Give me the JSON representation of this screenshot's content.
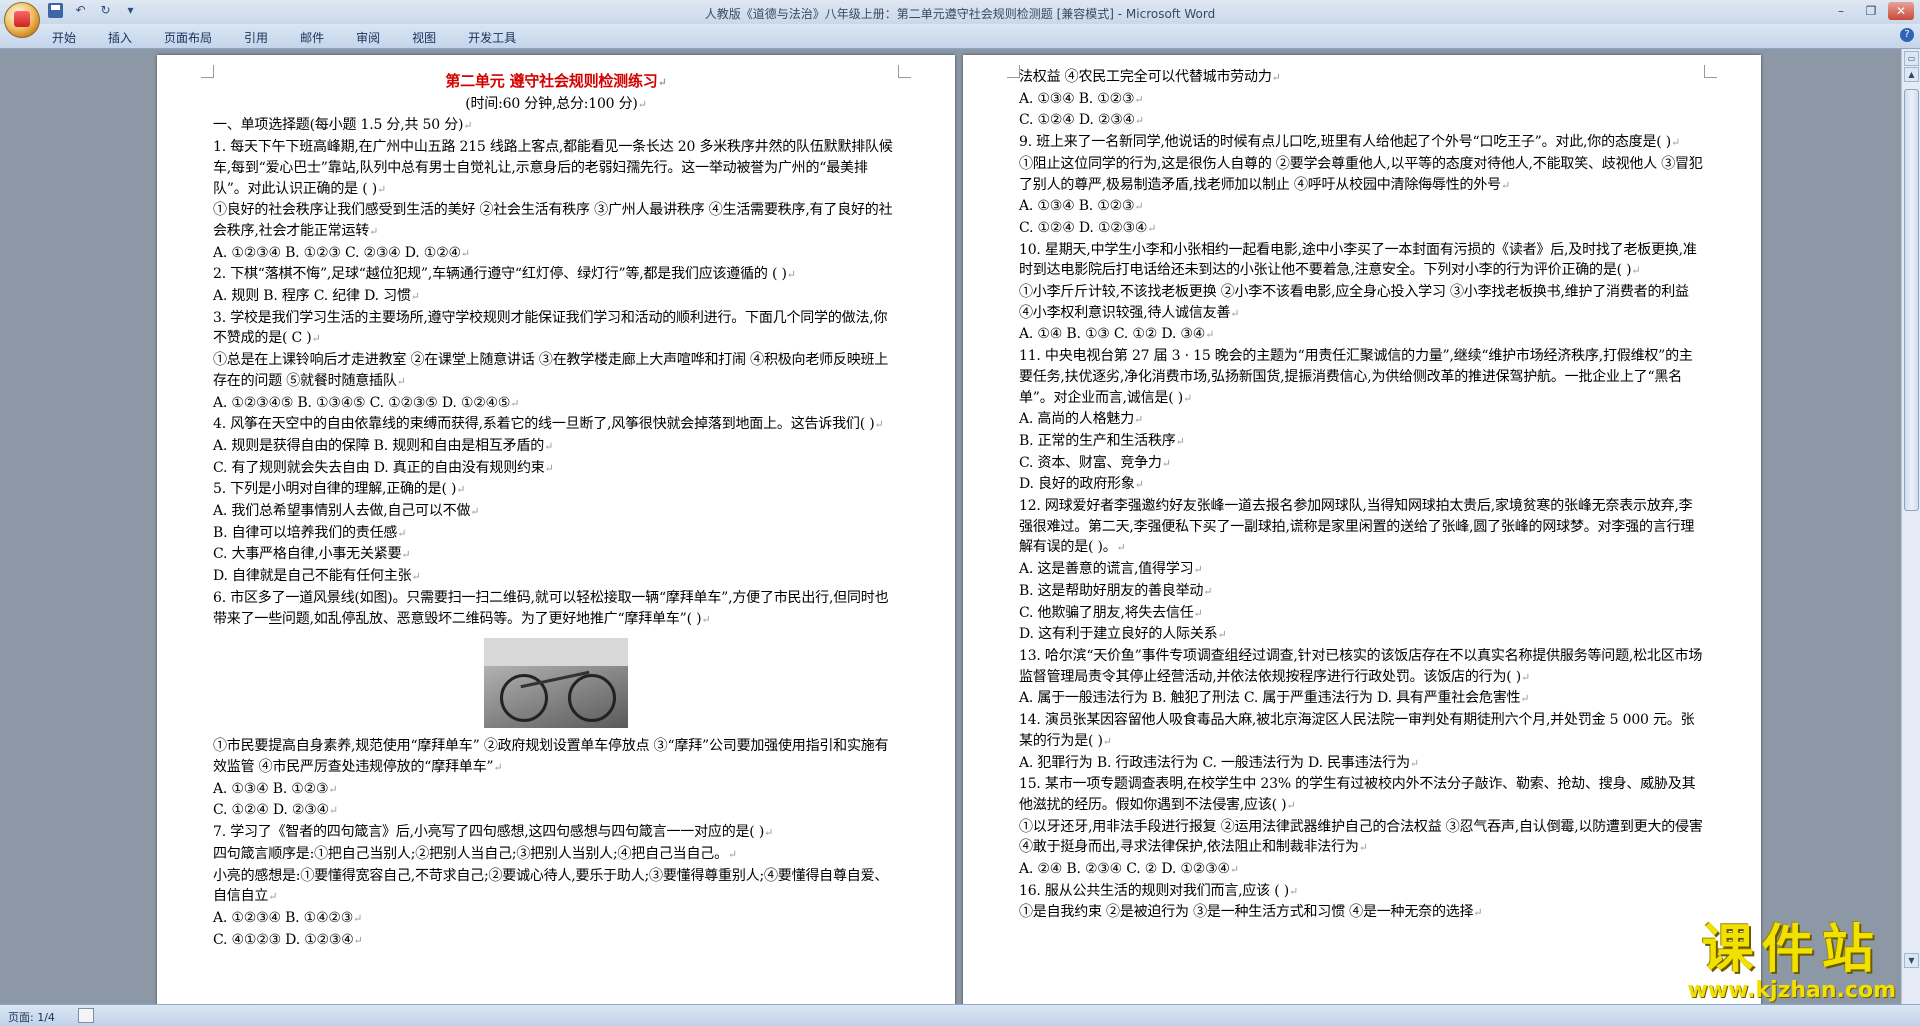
{
  "window": {
    "title": "人教版《道德与法治》八年级上册：第二单元遵守社会规则检测题 [兼容模式] - Microsoft Word"
  },
  "ribbon": {
    "tabs": [
      "开始",
      "插入",
      "页面布局",
      "引用",
      "邮件",
      "审阅",
      "视图",
      "开发工具"
    ]
  },
  "status": {
    "page": "页面: 1/4"
  },
  "watermark": {
    "logo": "课件站",
    "url": "www.kjzhan.com"
  },
  "document": {
    "title": "第二单元  遵守社会规则检测练习",
    "time": "(时间:60 分钟,总分:100 分)",
    "left_page": [
      {
        "t": "一、单项选择题(每小题 1.5 分,共 50 分)"
      },
      {
        "t": "1. 每天下午下班高峰期,在广州中山五路 215 线路上客点,都能看见一条长达 20 多米秩序井然的队伍默默排队候车,每到“爱心巴士”靠站,队列中总有男士自觉礼让,示意身后的老弱妇孺先行。这一举动被誉为广州的“最美排队”。对此认识正确的是                 (      )",
        "w": 1
      },
      {
        "t": "①良好的社会秩序让我们感受到生活的美好   ②社会生活有秩序   ③广州人最讲秩序   ④生活需要秩序,有了良好的社会秩序,社会才能正常运转",
        "w": 1
      },
      {
        "t": "A. ①②③④          B. ①②③               C. ②③④  D. ①②④"
      },
      {
        "t": "2. 下棋“落棋不悔”,足球“越位犯规”,车辆通行遵守“红灯停、绿灯行”等,都是我们应该遵循的                                                                                  (      )",
        "w": 1
      },
      {
        "t": "A. 规则               B. 程序               C. 纪律               D. 习惯"
      },
      {
        "t": "3. 学校是我们学习生活的主要场所,遵守学校规则才能保证我们学习和活动的顺利进行。下面几个同学的做法,你不赞成的是( C  )",
        "w": 1
      },
      {
        "t": "①总是在上课铃响后才走进教室   ②在课堂上随意讲话   ③在教学楼走廊上大声喧哗和打闹   ④积极向老师反映班上存在的问题   ⑤就餐时随意插队",
        "w": 1
      },
      {
        "t": "A. ①②③④⑤          B. ①③④⑤             C. ①②③⑤                   D. ①②④⑤"
      },
      {
        "t": "4. 风筝在天空中的自由依靠线的束缚而获得,系着它的线一旦断了,风筝很快就会掉落到地面上。这告诉我们(    )",
        "w": 1
      },
      {
        "t": "A. 规则是获得自由的保障              B. 规则和自由是相互矛盾的"
      },
      {
        "t": "C. 有了规则就会失去自由              D. 真正的自由没有规则约束"
      },
      {
        "t": "5. 下列是小明对自律的理解,正确的是(    )"
      },
      {
        "t": "A. 我们总希望事情别人去做,自己可以不做"
      },
      {
        "t": "B. 自律可以培养我们的责任感"
      },
      {
        "t": "C. 大事严格自律,小事无关紧要"
      },
      {
        "t": "D. 自律就是自己不能有任何主张"
      },
      {
        "t": "6. 市区多了一道风景线(如图)。只需要扫一扫二维码,就可以轻松接取一辆“摩拜单车”,方便了市民出行,但同时也带来了一些问题,如乱停乱放、恶意毁坏二维码等。为了更好地推广“摩拜单车”(      )",
        "w": 1
      },
      {
        "img": 1
      },
      {
        "t": "①市民要提高自身素养,规范使用“摩拜单车”   ②政府规划设置单车停放点   ③“摩拜”公司要加强使用指引和实施有效监管   ④市民严厉查处违规停放的“摩拜单车”",
        "w": 1
      },
      {
        "t": "A. ①③④          B. ①②③"
      },
      {
        "t": "C. ①②④          D. ②③④"
      },
      {
        "t": "7. 学习了《智者的四句箴言》后,小亮写了四句感想,这四句感想与四句箴言一一对应的是(      )"
      },
      {
        "t": "四句箴言顺序是:①把自己当别人;②把别人当自己;③把别人当别人;④把自己当自己。"
      },
      {
        "t": "小亮的感想是:①要懂得宽容自己,不苛求自己;②要诚心待人,要乐于助人;③要懂得尊重别人;④要懂得自尊自爱、自信自立",
        "w": 1
      },
      {
        "t": "A. ①②③④          B. ①④②③"
      },
      {
        "t": "C. ④①②③          D. ①②③④"
      }
    ],
    "right_page": [
      {
        "t": "法权益   ④农民工完全可以代替城市劳动力"
      },
      {
        "t": "A. ①③④               B. ①②③"
      },
      {
        "t": "C. ①②④               D. ②③④"
      },
      {
        "t": "9. 班上来了一名新同学,他说话的时候有点儿口吃,班里有人给他起了个外号“口吃王子”。对此,你的态度是(    )",
        "w": 1
      },
      {
        "t": "①阻止这位同学的行为,这是很伤人自尊的   ②要学会尊重他人,以平等的态度对待他人,不能取笑、歧视他人   ③冒犯了别人的尊严,极易制造矛盾,找老师加以制止   ④呼吁从校园中清除侮辱性的外号",
        "w": 1
      },
      {
        "t": "A. ①③④               B. ①②③"
      },
      {
        "t": "C. ①②④               D. ①②③④"
      },
      {
        "t": "10. 星期天,中学生小李和小张相约一起看电影,途中小李买了一本封面有污损的《读者》后,及时找了老板更换,准时到达电影院后打电话给还未到达的小张让他不要着急,注意安全。下列对小李的行为评价正确的是(    )",
        "w": 1
      },
      {
        "t": "①小李斤斤计较,不该找老板更换   ②小李不该看电影,应全身心投入学习   ③小李找老板换书,维护了消费者的利益   ④小李权利意识较强,待人诚信友善",
        "w": 1
      },
      {
        "t": "A. ①④               B. ①③          C. ①②          D. ③④"
      },
      {
        "t": "11. 中央电视台第 27 届 3 · 15 晚会的主题为“用责任汇聚诚信的力量”,继续“维护市场经济秩序,打假维权”的主要任务,扶优逐劣,净化消费市场,弘扬新国货,提振消费信心,为供给侧改革的推进保驾护航。一批企业上了“黑名单”。对企业而言,诚信是(  )",
        "w": 1
      },
      {
        "t": "A. 高尚的人格魅力"
      },
      {
        "t": "B. 正常的生产和生活秩序"
      },
      {
        "t": "C. 资本、财富、竞争力"
      },
      {
        "t": "D. 良好的政府形象"
      },
      {
        "t": "12. 网球爱好者李强邀约好友张峰一道去报名参加网球队,当得知网球拍太贵后,家境贫寒的张峰无奈表示放弃,李强很难过。第二天,李强便私下买了一副球拍,谎称是家里闲置的送给了张峰,圆了张峰的网球梦。对李强的言行理解有误的是(      )。",
        "w": 1
      },
      {
        "t": "A. 这是善意的谎言,值得学习"
      },
      {
        "t": "B. 这是帮助好朋友的善良举动"
      },
      {
        "t": "C. 他欺骗了朋友,将失去信任"
      },
      {
        "t": "D. 这有利于建立良好的人际关系"
      },
      {
        "t": "13. 哈尔滨“天价鱼”事件专项调查组经过调查,针对已核实的该饭店存在不以真实名称提供服务等问题,松北区市场监督管理局责令其停止经营活动,并依法依规按程序进行行政处罚。该饭店的行为(    )",
        "w": 1
      },
      {
        "t": "A. 属于一般违法行为       B. 触犯了刑法       C. 属于严重违法行为   D. 具有严重社会危害性"
      },
      {
        "t": "14. 演员张某因容留他人吸食毒品大麻,被北京海淀区人民法院一审判处有期徒刑六个月,并处罚金 5 000 元。张某的行为是(  )",
        "w": 1
      },
      {
        "t": "A. 犯罪行为               B. 行政违法行为           C. 一般违法行为           D. 民事违法行为"
      },
      {
        "t": "15. 某市一项专题调查表明,在校学生中 23% 的学生有过被校内外不法分子敲诈、勒索、抢劫、搜身、威胁及其他滋扰的经历。假如你遇到不法侵害,应该(      )",
        "w": 1
      },
      {
        "t": "①以牙还牙,用非法手段进行报复   ②运用法律武器维护自己的合法权益   ③忍气吞声,自认倒霉,以防遭到更大的侵害   ④敢于挺身而出,寻求法律保护,依法阻止和制裁非法行为",
        "w": 1
      },
      {
        "t": "A. ②④               B. ②③④          C. ②            D. ①②③④"
      },
      {
        "t": "16. 服从公共生活的规则对我们而言,应该        (      )"
      },
      {
        "t": "①是自我约束   ②是被迫行为   ③是一种生活方式和习惯   ④是一种无奈的选择"
      }
    ]
  }
}
